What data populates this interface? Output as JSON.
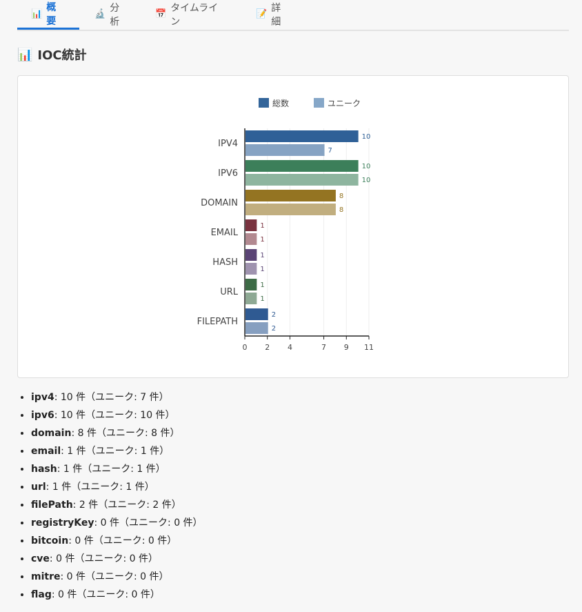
{
  "tabs": [
    {
      "icon": "📊",
      "label": "概要",
      "active": true
    },
    {
      "icon": "🔬",
      "label": "分析",
      "active": false
    },
    {
      "icon": "📅",
      "label": "タイムライン",
      "active": false
    },
    {
      "icon": "📝",
      "label": "詳細",
      "active": false
    }
  ],
  "section": {
    "icon": "📊",
    "title": "IOC統計"
  },
  "chart_data": {
    "type": "bar",
    "orientation": "horizontal",
    "categories": [
      "IPV4",
      "IPV6",
      "DOMAIN",
      "EMAIL",
      "HASH",
      "URL",
      "FILEPATH"
    ],
    "series": [
      {
        "name": "総数",
        "values": [
          10,
          10,
          8,
          1,
          1,
          1,
          2
        ]
      },
      {
        "name": "ユニーク",
        "values": [
          7,
          10,
          8,
          1,
          1,
          1,
          2
        ]
      }
    ],
    "category_colors": [
      "#2f6097",
      "#3c7f5a",
      "#947422",
      "#7a3340",
      "#5a4475",
      "#3d6b46",
      "#2f5a92"
    ],
    "xticks": [
      "0",
      "2",
      "4",
      "7",
      "9",
      "11"
    ],
    "xlim": [
      0,
      11
    ],
    "legend_position": "top",
    "grid": true
  },
  "summary": [
    {
      "key": "ipv4",
      "text": ": 10 件（ユニーク: 7 件）"
    },
    {
      "key": "ipv6",
      "text": ": 10 件（ユニーク: 10 件）"
    },
    {
      "key": "domain",
      "text": ": 8 件（ユニーク: 8 件）"
    },
    {
      "key": "email",
      "text": ": 1 件（ユニーク: 1 件）"
    },
    {
      "key": "hash",
      "text": ": 1 件（ユニーク: 1 件）"
    },
    {
      "key": "url",
      "text": ": 1 件（ユニーク: 1 件）"
    },
    {
      "key": "filePath",
      "text": ": 2 件（ユニーク: 2 件）"
    },
    {
      "key": "registryKey",
      "text": ": 0 件（ユニーク: 0 件）"
    },
    {
      "key": "bitcoin",
      "text": ": 0 件（ユニーク: 0 件）"
    },
    {
      "key": "cve",
      "text": ": 0 件（ユニーク: 0 件）"
    },
    {
      "key": "mitre",
      "text": ": 0 件（ユニーク: 0 件）"
    },
    {
      "key": "flag",
      "text": ": 0 件（ユニーク: 0 件）"
    }
  ]
}
